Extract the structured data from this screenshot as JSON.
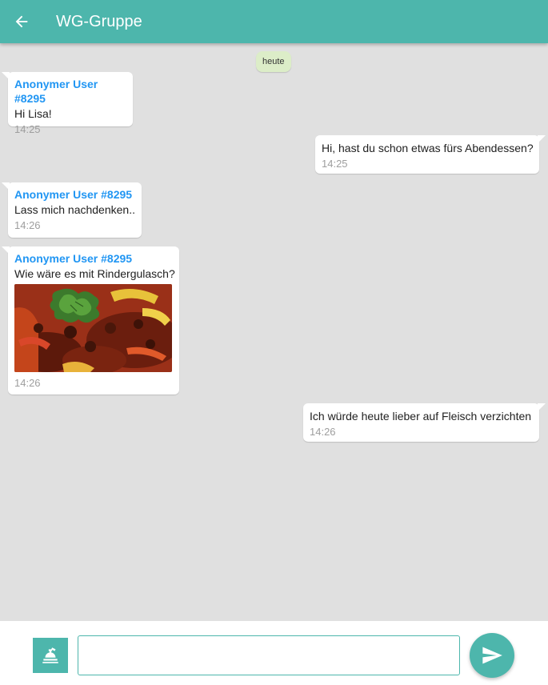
{
  "header": {
    "title": "WG-Gruppe",
    "back_icon": "arrow-left-icon",
    "bar_color": "#4db6ac"
  },
  "chat": {
    "date_chip": "heute",
    "messages": [
      {
        "direction": "incoming",
        "sender": "Anonymer User #8295",
        "text": "Hi Lisa!",
        "time": "14:25"
      },
      {
        "direction": "outgoing",
        "text": "Hi, hast du schon etwas fürs Abendessen?",
        "time": "14:25"
      },
      {
        "direction": "incoming",
        "sender": "Anonymer User #8295",
        "text": "Lass mich nachdenken..",
        "time": "14:26"
      },
      {
        "direction": "incoming",
        "sender": "Anonymer User #8295",
        "text": "Wie wäre es mit Rindergulasch?",
        "image": "goulash-photo",
        "time": "14:26"
      },
      {
        "direction": "outgoing",
        "text": "Ich würde heute lieber auf Fleisch verzichten",
        "time": "14:26"
      }
    ],
    "sender_color": "#2196f3"
  },
  "composer": {
    "attach_icon": "restaurant-menu-icon",
    "input_value": "",
    "send_icon": "send-icon"
  }
}
